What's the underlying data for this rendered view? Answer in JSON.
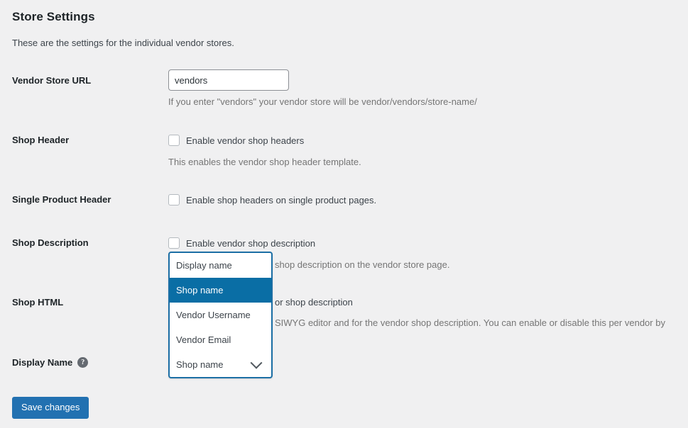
{
  "header": {
    "title": "Store Settings",
    "subtitle": "These are the settings for the individual vendor stores."
  },
  "rows": {
    "vendor_store_url": {
      "label": "Vendor Store URL",
      "value": "vendors",
      "placeholder": "",
      "help": "If you enter \"vendors\" your vendor store will be vendor/vendors/store-name/"
    },
    "shop_header": {
      "label": "Shop Header",
      "checkbox_label": "Enable vendor shop headers",
      "checked": false,
      "help": "This enables the vendor shop header template."
    },
    "single_product_header": {
      "label": "Single Product Header",
      "checkbox_label": "Enable shop headers on single product pages.",
      "checked": false
    },
    "shop_description": {
      "label": "Shop Description",
      "checkbox_label": "Enable vendor shop description",
      "checked": false,
      "help": "shop description on the vendor store page."
    },
    "shop_html": {
      "label": "Shop HTML",
      "checkbox_label": "or shop description",
      "checked": false,
      "help": "SIWYG editor and for the vendor shop description. You can enable or disable this per vendor by"
    },
    "display_name": {
      "label": "Display Name",
      "help_icon": "question-mark-icon",
      "selected_value": "Shop name",
      "options": [
        "Display name",
        "Shop name",
        "Vendor Username",
        "Vendor Email"
      ],
      "highlighted_option": "Shop name"
    }
  },
  "footer": {
    "save_label": "Save changes"
  },
  "colors": {
    "background": "#f0f0f1",
    "accent_blue": "#2271b1",
    "dropdown_highlight": "#0a6ea5",
    "dropdown_border": "#1c6fa5",
    "label_text": "#1d2327",
    "help_text": "#757575"
  }
}
